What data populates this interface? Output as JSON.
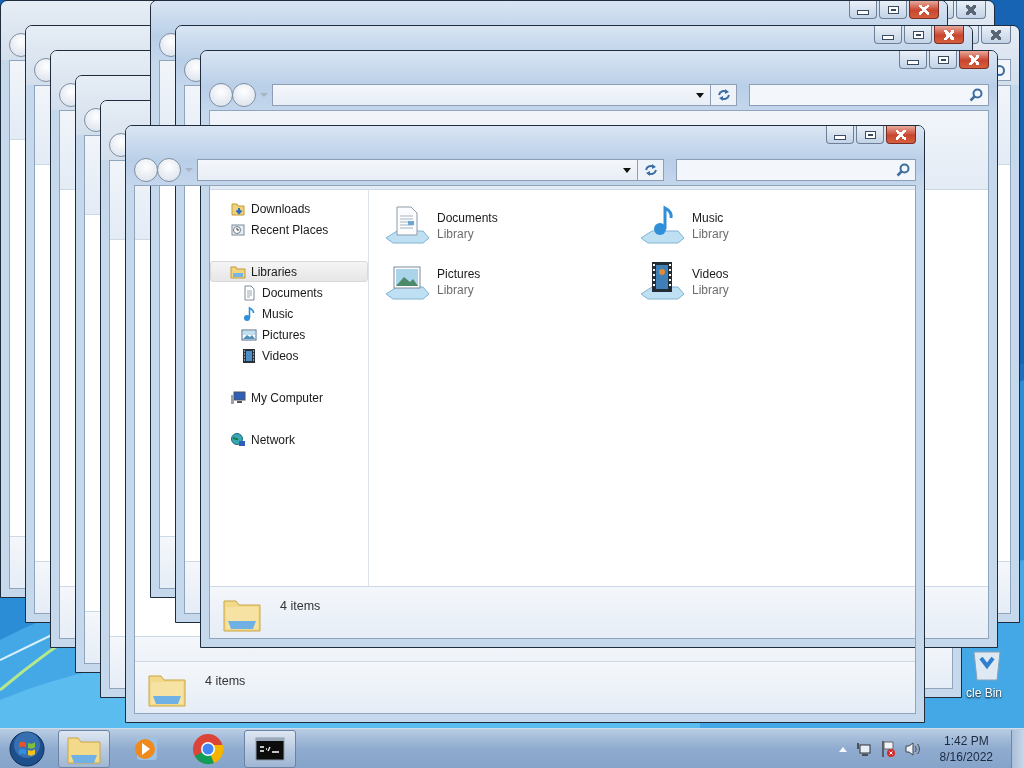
{
  "desktop": {
    "icons": [
      {
        "label": "cle Bin"
      }
    ]
  },
  "windows": [
    {
      "kind": "frame",
      "active": false
    },
    {
      "kind": "frame",
      "active": false
    },
    {
      "kind": "frame",
      "active": false
    },
    {
      "kind": "frame",
      "active": false
    },
    {
      "kind": "frame",
      "active": false
    },
    {
      "kind": "frame",
      "active": true
    },
    {
      "kind": "frame",
      "active": true
    },
    {
      "kind": "explorer",
      "active": true,
      "sidebar": [
        [
          {
            "label": "Downloads",
            "selected": false
          },
          {
            "label": "Recent Places",
            "selected": false
          }
        ],
        [
          {
            "label": "Libraries",
            "selected": true,
            "children": [
              {
                "label": "Documents",
                "selected": false
              },
              {
                "label": "Music",
                "selected": false
              },
              {
                "label": "Pictures",
                "selected": false
              },
              {
                "label": "Videos",
                "selected": false
              }
            ]
          }
        ],
        [
          {
            "label": "My Computer",
            "selected": false
          }
        ],
        [
          {
            "label": "Network",
            "selected": false
          }
        ]
      ],
      "items": [
        {
          "name": "Documents",
          "subtitle": "Library"
        },
        {
          "name": "Music",
          "subtitle": "Library"
        },
        {
          "name": "Pictures",
          "subtitle": "Library"
        },
        {
          "name": "Videos",
          "subtitle": "Library"
        }
      ],
      "status": "4 items"
    },
    {
      "kind": "overlay",
      "active": true,
      "status": "4 items"
    }
  ],
  "taskbar": {
    "apps": [
      {
        "running": true
      },
      {
        "running": false
      },
      {
        "running": false
      },
      {
        "running": true
      }
    ],
    "clock": {
      "time": "1:42 PM",
      "date": "8/16/2022"
    }
  }
}
